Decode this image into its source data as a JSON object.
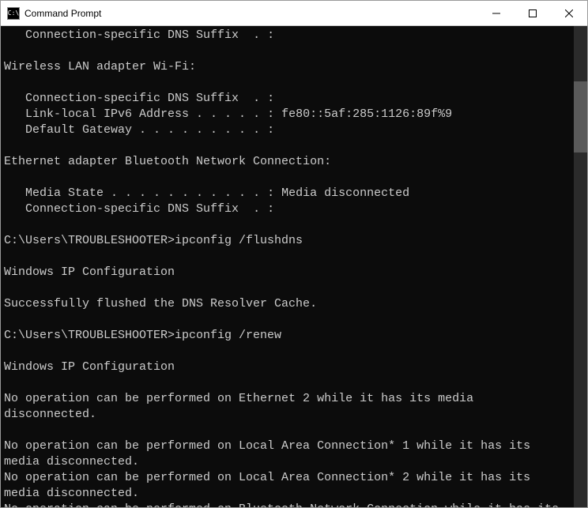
{
  "window": {
    "title": "Command Prompt",
    "icon_label": "cmd-icon"
  },
  "controls": {
    "minimize": "minimize-button",
    "maximize": "maximize-button",
    "close": "close-button"
  },
  "terminal": {
    "lines": [
      "   Connection-specific DNS Suffix  . :",
      "",
      "Wireless LAN adapter Wi-Fi:",
      "",
      "   Connection-specific DNS Suffix  . :",
      "   Link-local IPv6 Address . . . . . : fe80::5af:285:1126:89f%9",
      "   Default Gateway . . . . . . . . . :",
      "",
      "Ethernet adapter Bluetooth Network Connection:",
      "",
      "   Media State . . . . . . . . . . . : Media disconnected",
      "   Connection-specific DNS Suffix  . :",
      "",
      "C:\\Users\\TROUBLESHOOTER>ipconfig /flushdns",
      "",
      "Windows IP Configuration",
      "",
      "Successfully flushed the DNS Resolver Cache.",
      "",
      "C:\\Users\\TROUBLESHOOTER>ipconfig /renew",
      "",
      "Windows IP Configuration",
      "",
      "No operation can be performed on Ethernet 2 while it has its media disconnected.",
      "",
      "No operation can be performed on Local Area Connection* 1 while it has its media disconnected.",
      "No operation can be performed on Local Area Connection* 2 while it has its media disconnected.",
      "No operation can be performed on Bluetooth Network Connection while it has its m"
    ]
  }
}
